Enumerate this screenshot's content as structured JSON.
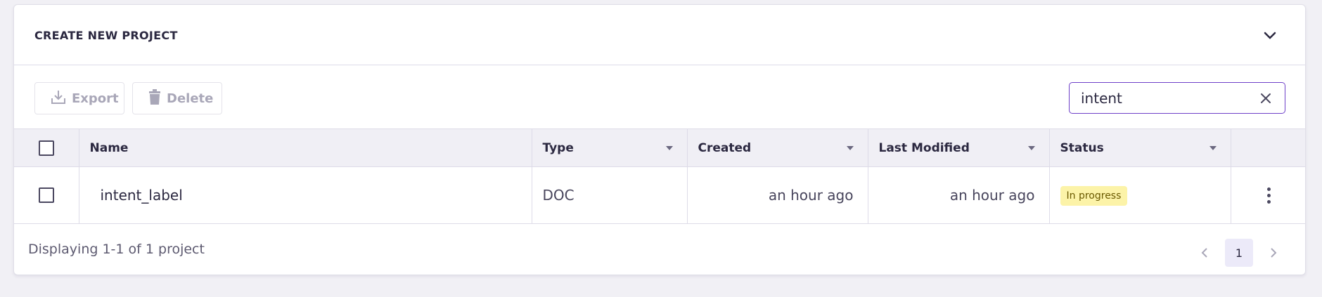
{
  "header": {
    "title": "CREATE NEW PROJECT",
    "collapse_icon": "chevron-down-icon"
  },
  "toolbar": {
    "export_label": "Export",
    "delete_label": "Delete",
    "search_value": "intent",
    "clear_icon": "close-icon"
  },
  "table": {
    "columns": [
      "Name",
      "Type",
      "Created",
      "Last Modified",
      "Status"
    ],
    "rows": [
      {
        "name": "intent_label",
        "type": "DOC",
        "created": "an hour ago",
        "modified": "an hour ago",
        "status": "In progress"
      }
    ]
  },
  "footer": {
    "summary": "Displaying 1-1 of 1 project",
    "current_page": "1"
  },
  "colors": {
    "accent": "#6e3fc8",
    "status_badge_bg": "#fcf3a8",
    "header_bg": "#f0eff5",
    "page_bg": "#f1f0f5"
  }
}
